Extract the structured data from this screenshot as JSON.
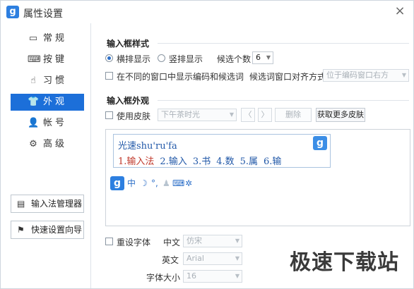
{
  "window": {
    "title": "属性设置",
    "logo_glyph": "g",
    "close_glyph": "×"
  },
  "sidebar": {
    "items": [
      {
        "label": "常规",
        "icon": "monitor-icon",
        "glyph": "▭"
      },
      {
        "label": "按键",
        "icon": "keyboard-icon",
        "glyph": "⌨"
      },
      {
        "label": "习惯",
        "icon": "mouse-icon",
        "glyph": "☝"
      },
      {
        "label": "外观",
        "icon": "shirt-icon",
        "glyph": "👕"
      },
      {
        "label": "帐号",
        "icon": "user-icon",
        "glyph": "👤"
      },
      {
        "label": "高级",
        "icon": "gear-icon",
        "glyph": "⚙"
      }
    ],
    "active": "外观",
    "ime_manager_label": "输入法管理器",
    "ime_manager_icon": "list-icon",
    "ime_manager_glyph": "▤",
    "quick_setup_label": "快速设置向导",
    "quick_setup_icon": "flag-icon",
    "quick_setup_glyph": "⚑"
  },
  "input_style": {
    "section_title": "输入框样式",
    "horizontal_label": "横排显示",
    "vertical_label": "竖排显示",
    "horizontal_checked": true,
    "candidate_count_label": "候选个数",
    "candidate_count_value": "6",
    "separate_window_label": "在不同的窗口中显示编码和候选词",
    "separate_window_checked": false,
    "align_label": "候选词窗口对齐方式",
    "align_value": "位于编码窗口右方"
  },
  "appearance": {
    "section_title": "输入框外观",
    "use_skin_label": "使用皮肤",
    "use_skin_checked": false,
    "skin_value": "下午茶时光",
    "prev_glyph": "〈",
    "next_glyph": "〉",
    "delete_label": "删除",
    "more_skins_label": "获取更多皮肤"
  },
  "preview": {
    "pinyin_text": "光速shu'ru'fa",
    "candidates": [
      "1.输入法",
      "2.输入",
      "3.书",
      "4.数",
      "5.属",
      "6.输"
    ],
    "logo_glyph": "g",
    "status_items": [
      {
        "glyph": "中",
        "icon": "chinese-mode-icon"
      },
      {
        "glyph": "☽",
        "icon": "moon-icon"
      },
      {
        "glyph": "°,",
        "icon": "punctuation-icon"
      },
      {
        "glyph": "♟",
        "icon": "user-status-icon"
      },
      {
        "glyph": "⌨",
        "icon": "soft-keyboard-icon"
      },
      {
        "glyph": "✲",
        "icon": "settings-icon"
      }
    ]
  },
  "font": {
    "reset_label": "重设字体",
    "reset_checked": false,
    "chinese_label": "中文",
    "chinese_value": "仿宋",
    "english_label": "英文",
    "english_value": "Arial",
    "size_label": "字体大小",
    "size_value": "16"
  },
  "watermark": "极速下载站",
  "colors": {
    "accent": "#1c6fd9",
    "brand": "#2d7fe0",
    "candidate_first": "#c0392b",
    "candidate": "#2158a8"
  }
}
